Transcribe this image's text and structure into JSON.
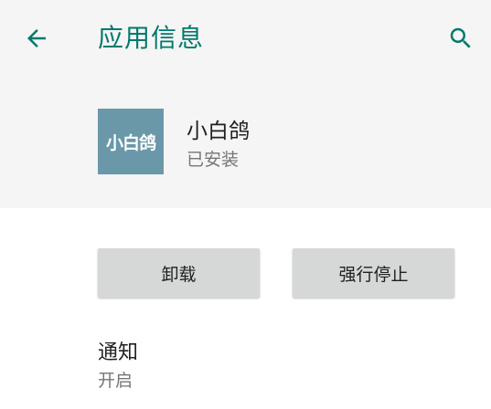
{
  "app_bar": {
    "title": "应用信息",
    "back_icon": "arrow-back-icon",
    "search_icon": "search-icon",
    "accent_color": "#00796b"
  },
  "app_header": {
    "icon_text": "小白鸽",
    "icon_color": "#6a98a8",
    "name": "小白鸽",
    "status": "已安装"
  },
  "actions": {
    "uninstall_label": "卸载",
    "force_stop_label": "强行停止"
  },
  "settings": {
    "notifications": {
      "title": "通知",
      "summary": "开启"
    }
  }
}
